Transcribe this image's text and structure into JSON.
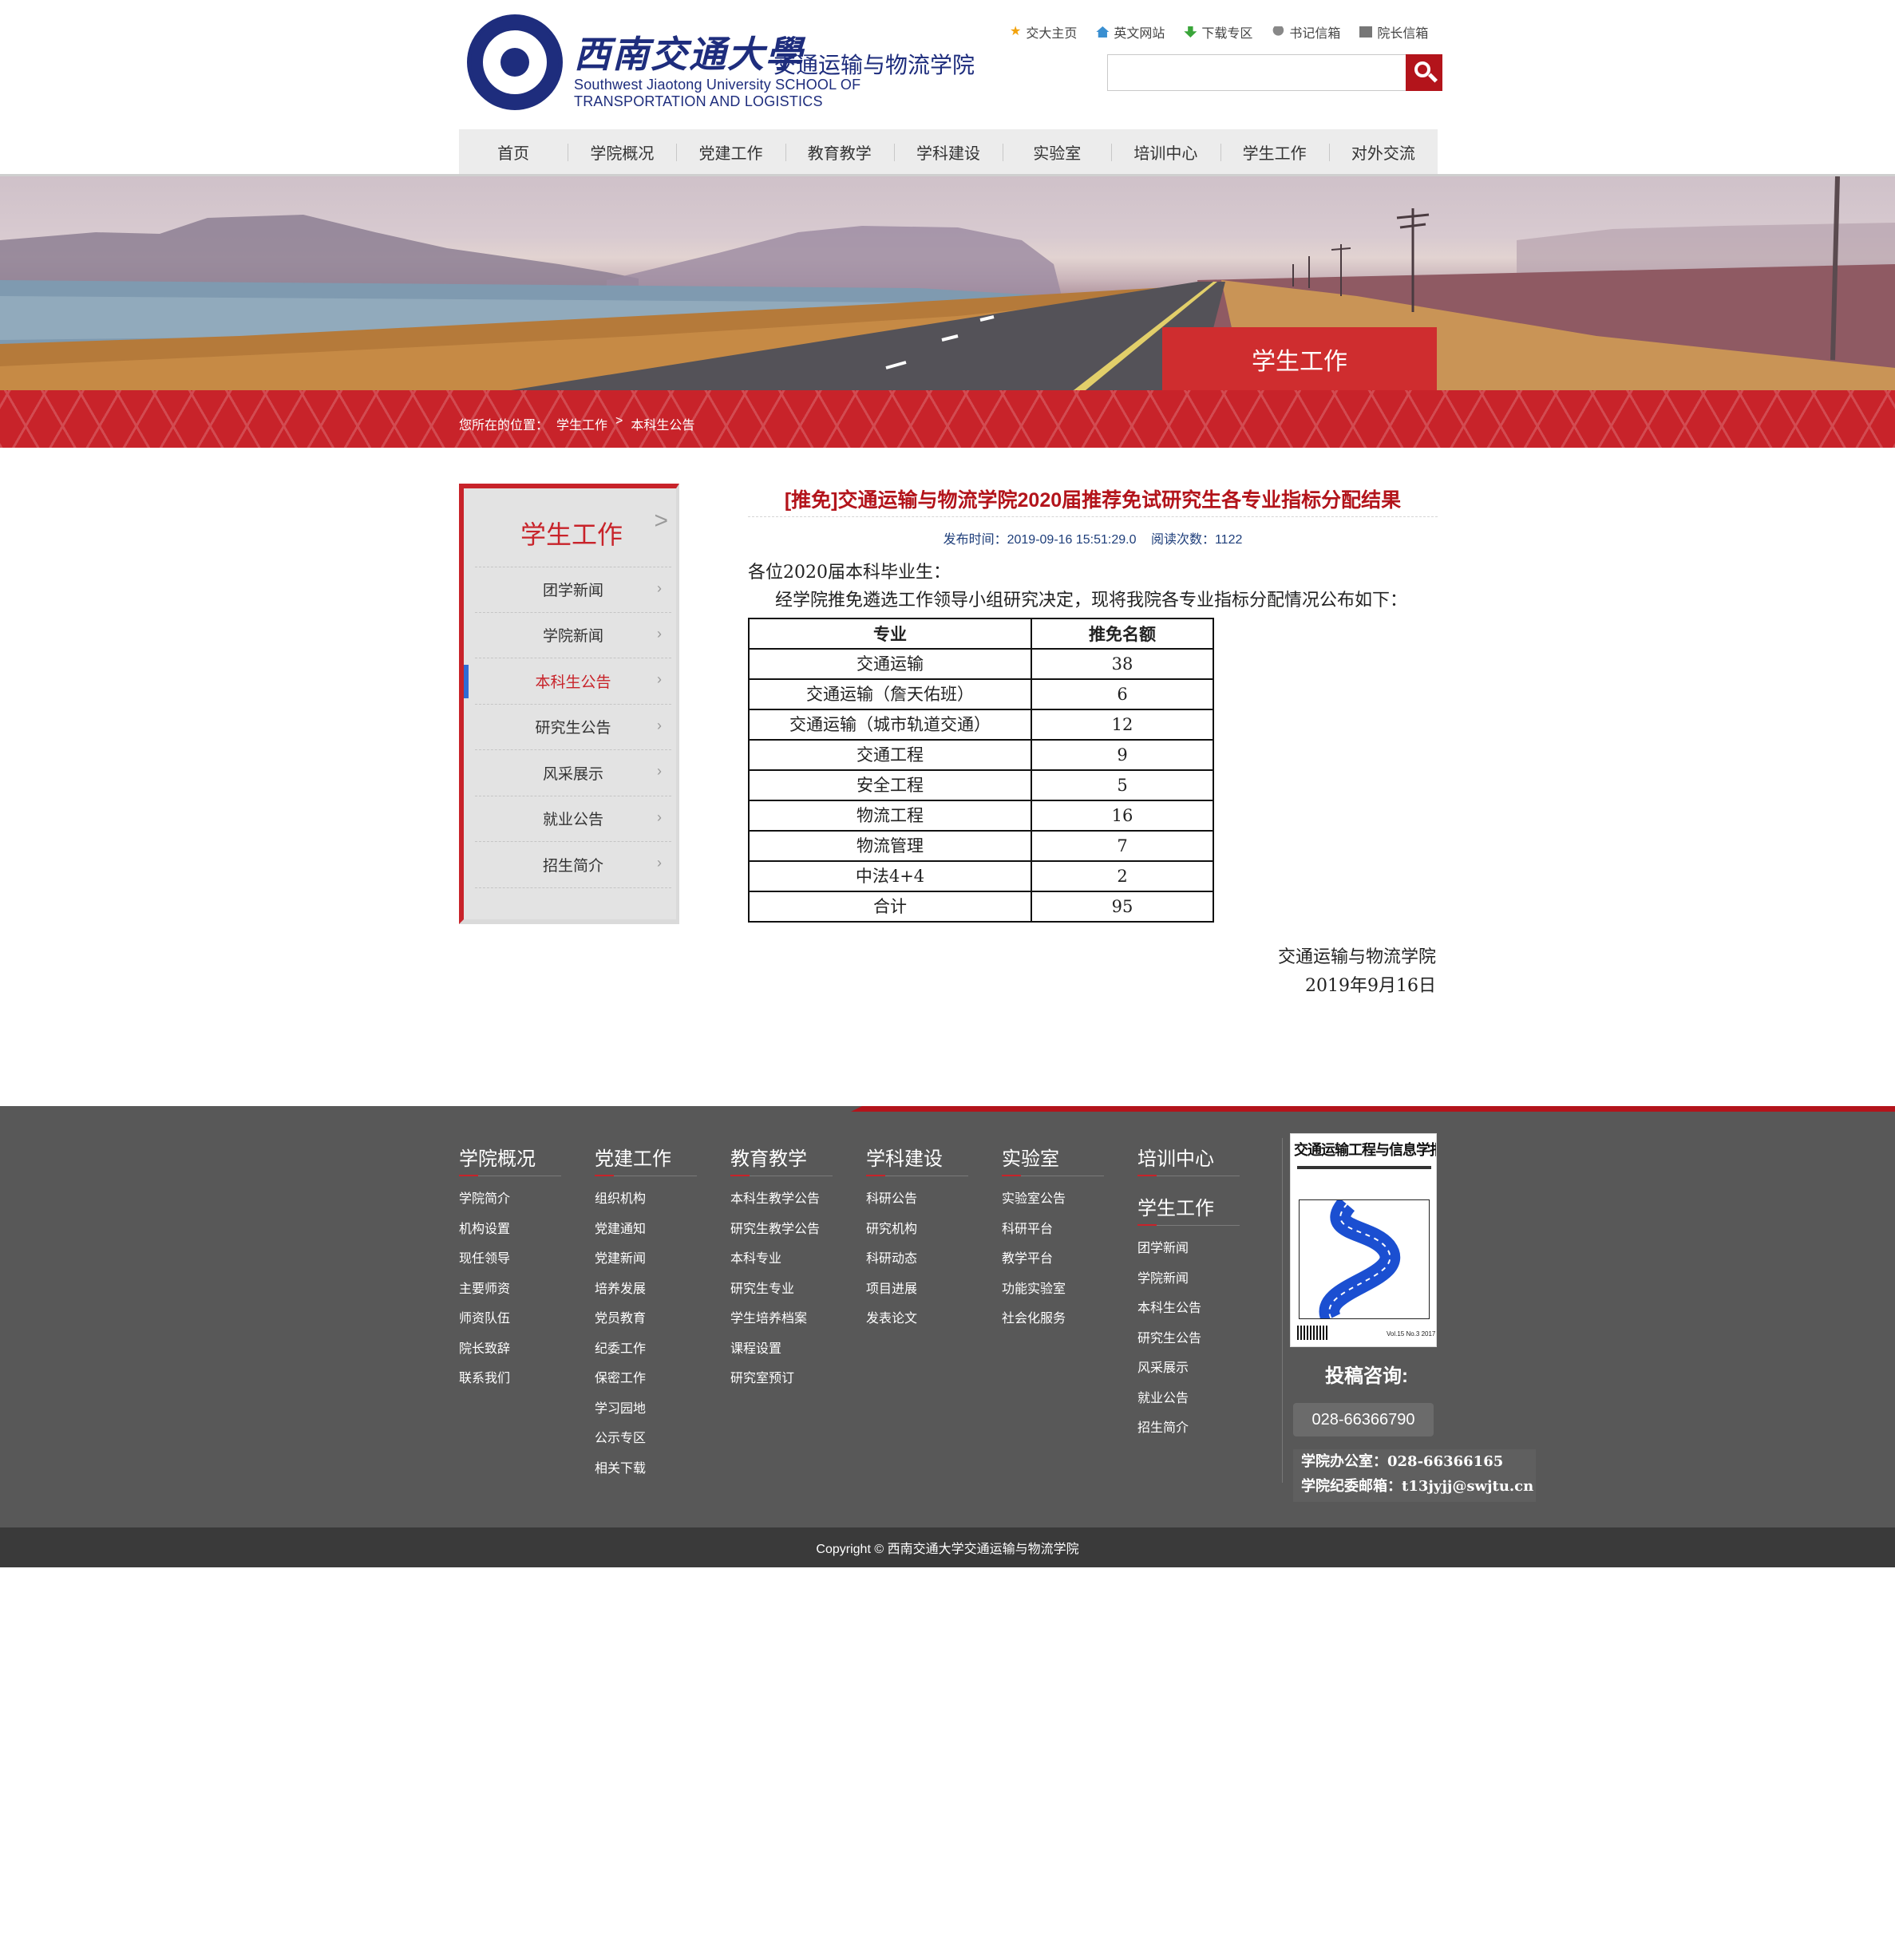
{
  "header": {
    "logo_cn": "西南交通大學",
    "logo_cn2": "交通运输与物流学院",
    "logo_en": "Southwest Jiaotong University SCHOOL OF TRANSPORTATION AND LOGISTICS",
    "toplinks": [
      "交大主页",
      "英文网站",
      "下载专区",
      "书记信箱",
      "院长信箱"
    ],
    "search_placeholder": ""
  },
  "nav": [
    "首页",
    "学院概况",
    "党建工作",
    "教育教学",
    "学科建设",
    "实验室",
    "培训中心",
    "学生工作",
    "对外交流"
  ],
  "banner": {
    "label": "学生工作"
  },
  "breadcrumb": {
    "prefix": "您所在的位置：",
    "section": "学生工作",
    "sep": ">",
    "current": "本科生公告"
  },
  "sidebar": {
    "title": "学生工作",
    "items": [
      "团学新闻",
      "学院新闻",
      "本科生公告",
      "研究生公告",
      "风采展示",
      "就业公告",
      "招生简介"
    ],
    "active_index": 2
  },
  "article": {
    "title": "[推免]交通运输与物流学院2020届推荐免试研究生各专业指标分配结果",
    "published_label": "发布时间：2019-09-16 15:51:29.0",
    "views_label": "阅读次数：1122",
    "greeting": "各位2020届本科毕业生：",
    "paragraph": "经学院推免遴选工作领导小组研究决定，现将我院各专业指标分配情况公布如下：",
    "table": {
      "headers": [
        "专业",
        "推免名额"
      ],
      "rows": [
        [
          "交通运输",
          "38"
        ],
        [
          "交通运输（詹天佑班）",
          "6"
        ],
        [
          "交通运输（城市轨道交通）",
          "12"
        ],
        [
          "交通工程",
          "9"
        ],
        [
          "安全工程",
          "5"
        ],
        [
          "物流工程",
          "16"
        ],
        [
          "物流管理",
          "7"
        ],
        [
          "中法4+4",
          "2"
        ],
        [
          "合计",
          "95"
        ]
      ]
    },
    "signature": "交通运输与物流学院",
    "date": "2019年9月16日"
  },
  "footer": {
    "columns": [
      {
        "title": "学院概况",
        "links": [
          "学院简介",
          "机构设置",
          "现任领导",
          "主要师资",
          "师资队伍",
          "院长致辞",
          "联系我们"
        ]
      },
      {
        "title": "党建工作",
        "links": [
          "组织机构",
          "党建通知",
          "党建新闻",
          "培养发展",
          "党员教育",
          "纪委工作",
          "保密工作",
          "学习园地",
          "公示专区",
          "相关下载"
        ]
      },
      {
        "title": "教育教学",
        "links": [
          "本科生教学公告",
          "研究生教学公告",
          "本科专业",
          "研究生专业",
          "学生培养档案",
          "课程设置",
          "研究室预订"
        ]
      },
      {
        "title": "学科建设",
        "links": [
          "科研公告",
          "研究机构",
          "科研动态",
          "项目进展",
          "发表论文"
        ]
      },
      {
        "title": "实验室",
        "links": [
          "实验室公告",
          "科研平台",
          "教学平台",
          "功能实验室",
          "社会化服务"
        ]
      }
    ],
    "col6_title_a": "培训中心",
    "col6_title_b": "学生工作",
    "col6_links": [
      "团学新闻",
      "学院新闻",
      "本科生公告",
      "研究生公告",
      "风采展示",
      "就业公告",
      "招生简介"
    ],
    "journal_title": "交通运输工程与信息学报",
    "journal_issue": "Vol.15 No.3 2017",
    "contact_title": "投稿咨询:",
    "contact_phone": "028-66366790",
    "office_phone": "学院办公室：028-66366165",
    "office_email": "学院纪委邮箱：t13jyjj@swjtu.cn",
    "copyright": "Copyright  © 西南交通大学交通运输与物流学院"
  }
}
